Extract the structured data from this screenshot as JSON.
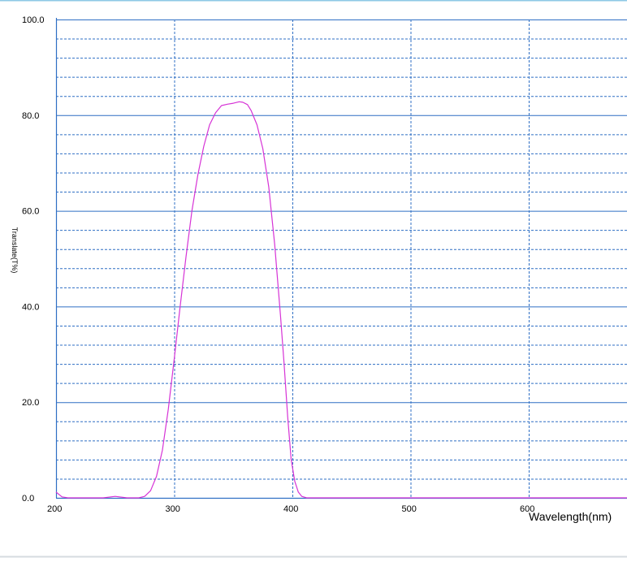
{
  "chart_data": {
    "type": "line",
    "xlabel": "Wavelength(nm)",
    "ylabel": "Translate(T%)",
    "xlim": [
      200,
      690
    ],
    "ylim": [
      0,
      100
    ],
    "x_ticks": [
      200,
      300,
      400,
      500,
      600
    ],
    "x_tick_labels": [
      "200",
      "300",
      "400",
      "500",
      "600"
    ],
    "y_ticks": [
      0,
      20,
      40,
      60,
      80,
      100
    ],
    "y_tick_labels": [
      "0.0",
      "20.0",
      "40.0",
      "60.0",
      "80.0",
      "100.0"
    ],
    "grid": true,
    "colors": {
      "line": "#d633d6",
      "axis": "#2f6fc4",
      "grid": "#2f6fc4",
      "frame_top": "#8ec9e6",
      "frame_bottom": "#d6dbe0"
    },
    "series": [
      {
        "x": [
          200,
          205,
          210,
          220,
          240,
          250,
          260,
          270,
          275,
          280,
          285,
          290,
          295,
          300,
          305,
          310,
          315,
          320,
          325,
          330,
          335,
          340,
          345,
          350,
          355,
          358,
          362,
          365,
          370,
          375,
          380,
          385,
          390,
          393,
          396,
          399,
          402,
          405,
          408,
          412,
          420,
          450,
          500,
          550,
          600,
          650,
          690
        ],
        "y": [
          1.2,
          0.2,
          0.0,
          0.0,
          0.0,
          0.3,
          0.0,
          0.0,
          0.3,
          1.5,
          4.5,
          10.0,
          18.5,
          29.0,
          40.0,
          50.5,
          60.0,
          67.5,
          73.5,
          78.0,
          80.5,
          82.0,
          82.3,
          82.5,
          82.8,
          82.7,
          82.2,
          81.0,
          78.0,
          73.0,
          65.0,
          53.0,
          38.0,
          28.0,
          17.0,
          8.0,
          3.5,
          1.2,
          0.3,
          0.0,
          0.0,
          0.0,
          0.0,
          0.0,
          0.0,
          0.0,
          0.0
        ]
      }
    ]
  }
}
